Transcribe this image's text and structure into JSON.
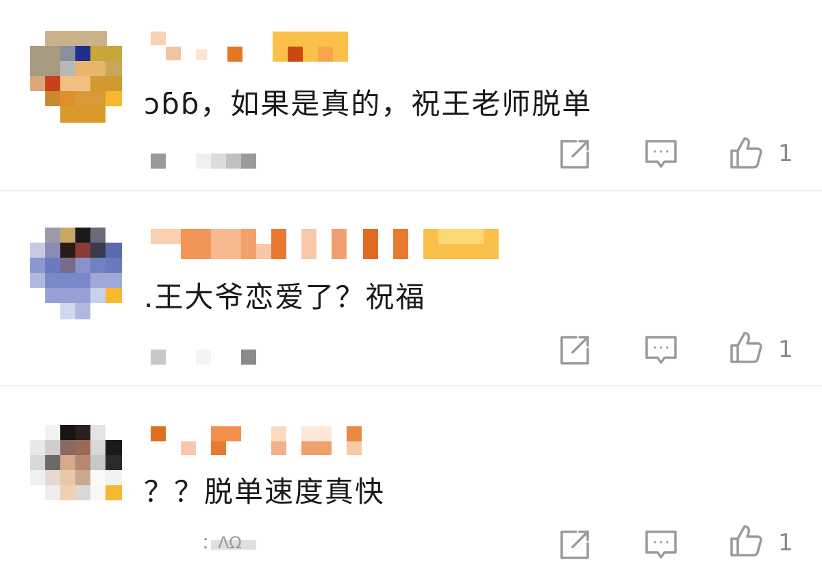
{
  "comments": [
    {
      "text": "ɔɓɓ，如果是真的，祝王老师脱单",
      "like_count": "1"
    },
    {
      "text": ".王大爷恋爱了？祝福",
      "like_count": "1"
    },
    {
      "text": "？？脱单速度真快",
      "like_count": "1",
      "time_fragment": "：ΛΩ"
    }
  ],
  "icons": {
    "share": "share-icon",
    "comment": "comment-icon",
    "like": "thumbs-up-icon"
  },
  "colors": {
    "text": "#1a1a1a",
    "icon": "#9a9a9a",
    "divider": "#efefef",
    "username_orange": "#e8792b"
  }
}
